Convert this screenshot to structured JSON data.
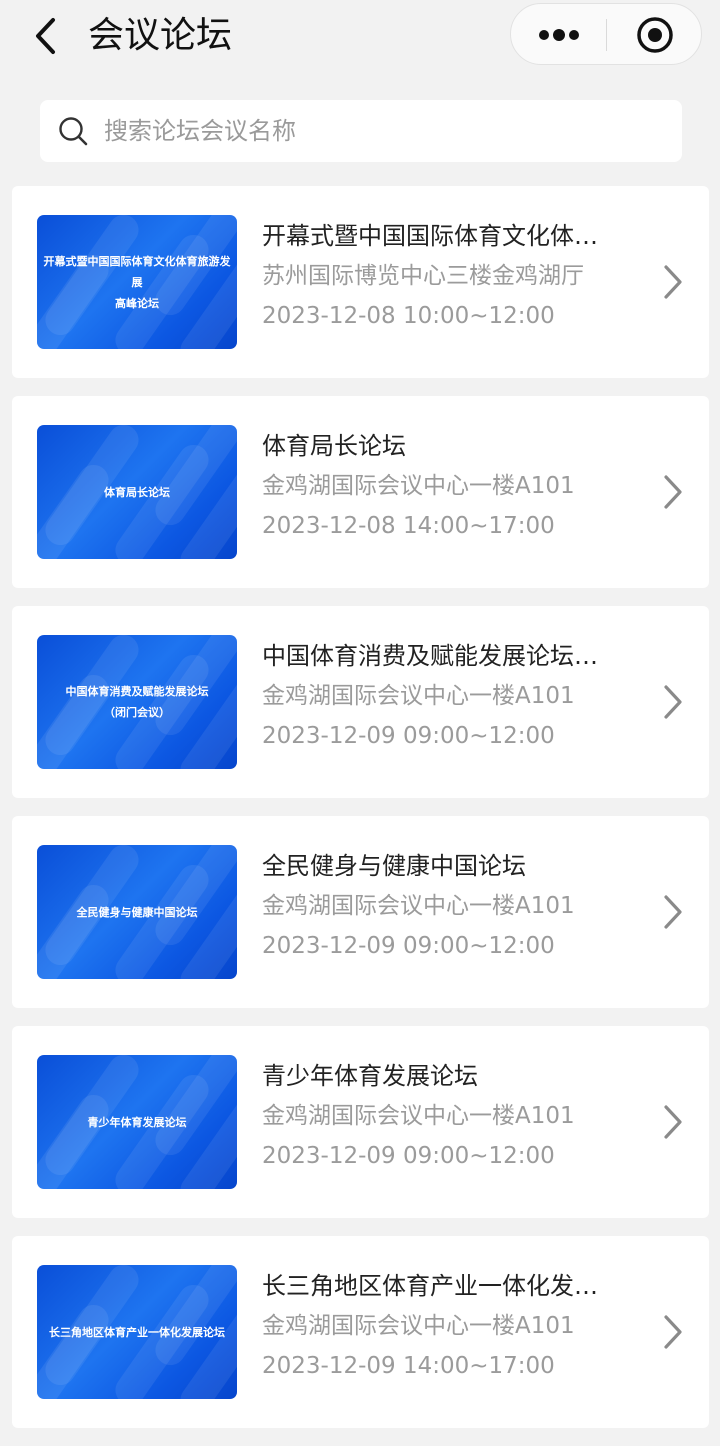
{
  "header": {
    "title": "会议论坛"
  },
  "search": {
    "placeholder": "搜索论坛会议名称",
    "value": ""
  },
  "forums": [
    {
      "thumb_lines": [
        "开幕式暨中国国际体育文化体育旅游发展",
        "高峰论坛"
      ],
      "title": "开幕式暨中国国际体育文化体育旅游发展高峰论坛",
      "venue": "苏州国际博览中心三楼金鸡湖厅",
      "time": "2023-12-08 10:00~12:00"
    },
    {
      "thumb_lines": [
        "体育局长论坛"
      ],
      "title": "体育局长论坛",
      "venue": "金鸡湖国际会议中心一楼A101",
      "time": "2023-12-08 14:00~17:00"
    },
    {
      "thumb_lines": [
        "中国体育消费及赋能发展论坛",
        "（闭门会议）"
      ],
      "title": "中国体育消费及赋能发展论坛（闭门会议）",
      "venue": "金鸡湖国际会议中心一楼A101",
      "time": "2023-12-09 09:00~12:00"
    },
    {
      "thumb_lines": [
        "全民健身与健康中国论坛"
      ],
      "title": "全民健身与健康中国论坛",
      "venue": "金鸡湖国际会议中心一楼A101",
      "time": "2023-12-09 09:00~12:00"
    },
    {
      "thumb_lines": [
        "青少年体育发展论坛"
      ],
      "title": "青少年体育发展论坛",
      "venue": "金鸡湖国际会议中心一楼A101",
      "time": "2023-12-09 09:00~12:00"
    },
    {
      "thumb_lines": [
        "长三角地区体育产业一体化发展论坛"
      ],
      "title": "长三角地区体育产业一体化发展论坛",
      "venue": "金鸡湖国际会议中心一楼A101",
      "time": "2023-12-09 14:00~17:00"
    }
  ],
  "colors": {
    "thumb_blue": "#1e74f0",
    "background": "#f2f2f2",
    "muted_text": "#9b9b9b"
  }
}
